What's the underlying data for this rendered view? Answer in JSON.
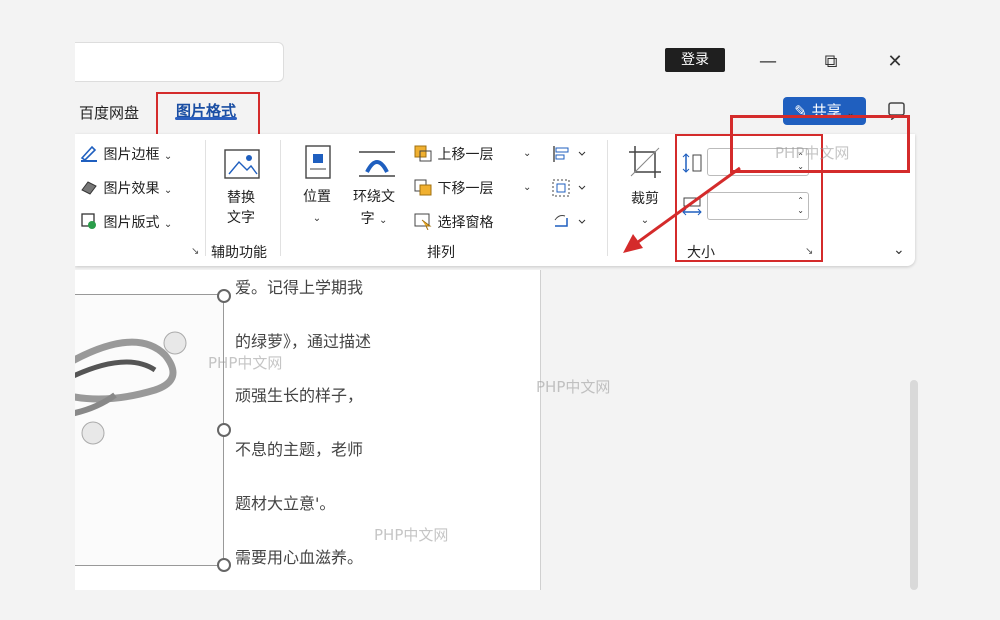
{
  "titlebar": {
    "login_label": "登录",
    "minimize_glyph": "—",
    "restore_glyph": "⧉",
    "close_glyph": "✕"
  },
  "tabs": {
    "baidu": "百度网盘",
    "picture_format": "图片格式"
  },
  "share_label": "共享",
  "ribbon": {
    "styles": {
      "border": "图片边框",
      "effects": "图片效果",
      "layout": "图片版式"
    },
    "accessibility": {
      "alt_text_line1": "替换",
      "alt_text_line2": "文字",
      "group_label": "辅助功能"
    },
    "arrange": {
      "position": "位置",
      "wrap_text_line1": "环绕文",
      "wrap_text_line2": "字",
      "bring_forward": "上移一层",
      "send_backward": "下移一层",
      "selection_pane": "选择窗格",
      "group_label": "排列"
    },
    "size": {
      "crop": "裁剪",
      "height_value": "",
      "width_value": "",
      "group_label": "大小"
    }
  },
  "document": {
    "lines": [
      "爱。记得上学期我",
      "的绿萝》，通过描述",
      "顽强生长的样子，",
      "不息的主题，老师",
      "题材大立意'。",
      "需要用心血滋养。"
    ]
  },
  "watermark": "PHP中文网",
  "colors": {
    "accent": "#1f5fbf",
    "highlight": "#d42b2b"
  }
}
